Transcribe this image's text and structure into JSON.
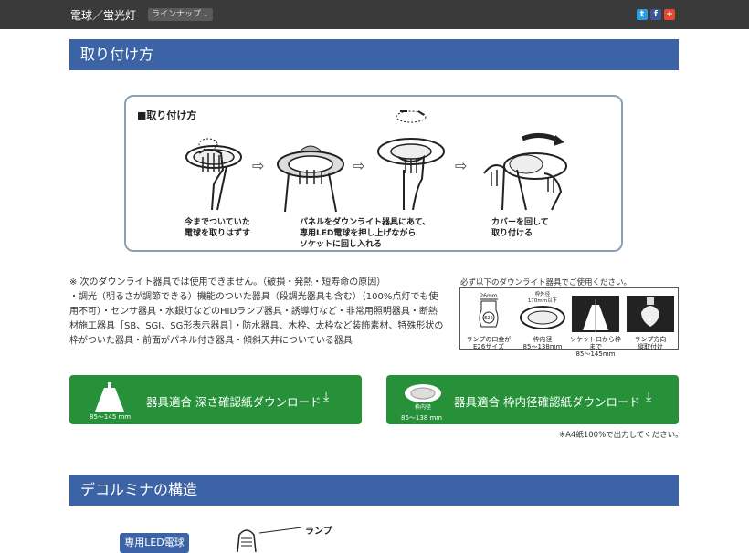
{
  "header": {
    "title": "電球／蛍光灯",
    "lineup_label": "ラインナップ",
    "social": [
      "twitter-icon",
      "facebook-icon",
      "google-plus-icon"
    ]
  },
  "section1": {
    "heading": "取り付け方",
    "box_title": "■取り付け方",
    "steps": [
      {
        "caption": "今までついていた\n電球を取りはずす"
      },
      {
        "caption": "パネルをダウンライト器具にあて、\n専用LED電球を押し上げながら\nソケットに回し入れる"
      },
      {
        "caption": "カバーを回して\n取り付ける"
      }
    ]
  },
  "notes": {
    "lines": [
      "※ 次のダウンライト器具では使用できません。（破損・発熱・短寿命の原因）",
      "・調光（明るさが調節できる）機能のついた器具（段調光器具も含む）（100%点灯でも使用不可）・センサ器具・水銀灯などのHIDランプ器具・誘導灯など・非常用照明器具・断熱材施工器具［SB、SGI、SG形表示器具］・防水器具、木枠、太枠など装飾素材、特殊形状の枠がついた器具・前面がパネル付き器具・傾斜天井についている器具"
    ]
  },
  "requirements": {
    "label": "必ず以下のダウンライト器具でご使用ください。",
    "items": [
      {
        "caption": "ランプの口金が\nE26サイズ",
        "top": "26mm",
        "mid": "E26"
      },
      {
        "caption": "枠内径\n85〜138mm",
        "top": "枠外径\n170mm以下"
      },
      {
        "caption": "ソケット口から枠まで\n85〜145mm"
      },
      {
        "caption": "ランプ方向\n縦取付け"
      }
    ]
  },
  "downloads": [
    {
      "label": "器具適合 深さ確認紙ダウンロード",
      "sub": "85〜145 mm"
    },
    {
      "label": "器具適合 枠内径確認紙ダウンロード",
      "sub": "85〜138 mm",
      "sub_top": "枠内径"
    }
  ],
  "a4_note": "※A4紙100%で出力してください。",
  "section2": {
    "heading": "デコルミナの構造",
    "badge": "専用LED電球",
    "lamp_label": "ランプ"
  },
  "colors": {
    "header_bg": "#3a3a3a",
    "section_blue": "#3c63a6",
    "download_green": "#27913a"
  }
}
